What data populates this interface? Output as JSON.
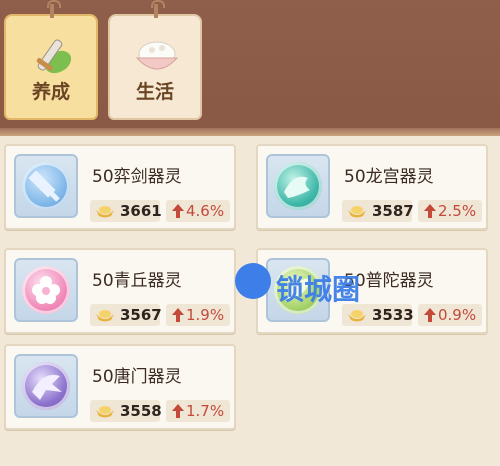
{
  "tabs": [
    {
      "label": "养成",
      "icon": "sword-leaf-icon"
    },
    {
      "label": "生活",
      "icon": "rice-bowl-icon"
    }
  ],
  "cards": [
    {
      "name": "50弈剑器灵",
      "price": "3661",
      "change": "4.6%",
      "icon": "sword-spirit-icon",
      "orb_color": "#7fb7e8"
    },
    {
      "name": "50龙宫器灵",
      "price": "3587",
      "change": "2.5%",
      "icon": "dragon-spirit-icon",
      "orb_color": "#3db7a8"
    },
    {
      "name": "50青丘器灵",
      "price": "3567",
      "change": "1.9%",
      "icon": "flower-spirit-icon",
      "orb_color": "#f08ab8"
    },
    {
      "name": "50普陀器灵",
      "price": "3533",
      "change": "0.9%",
      "icon": "leaf-spirit-icon",
      "orb_color": "#a6d46a"
    },
    {
      "name": "50唐门器灵",
      "price": "3558",
      "change": "1.7%",
      "icon": "claw-spirit-icon",
      "orb_color": "#8b72cc"
    }
  ],
  "watermark": {
    "text": "锁城圈"
  },
  "colors": {
    "accent_up": "#c44a3a",
    "header_bg": "#8f5f4b",
    "page_bg": "#f1e8d8"
  }
}
